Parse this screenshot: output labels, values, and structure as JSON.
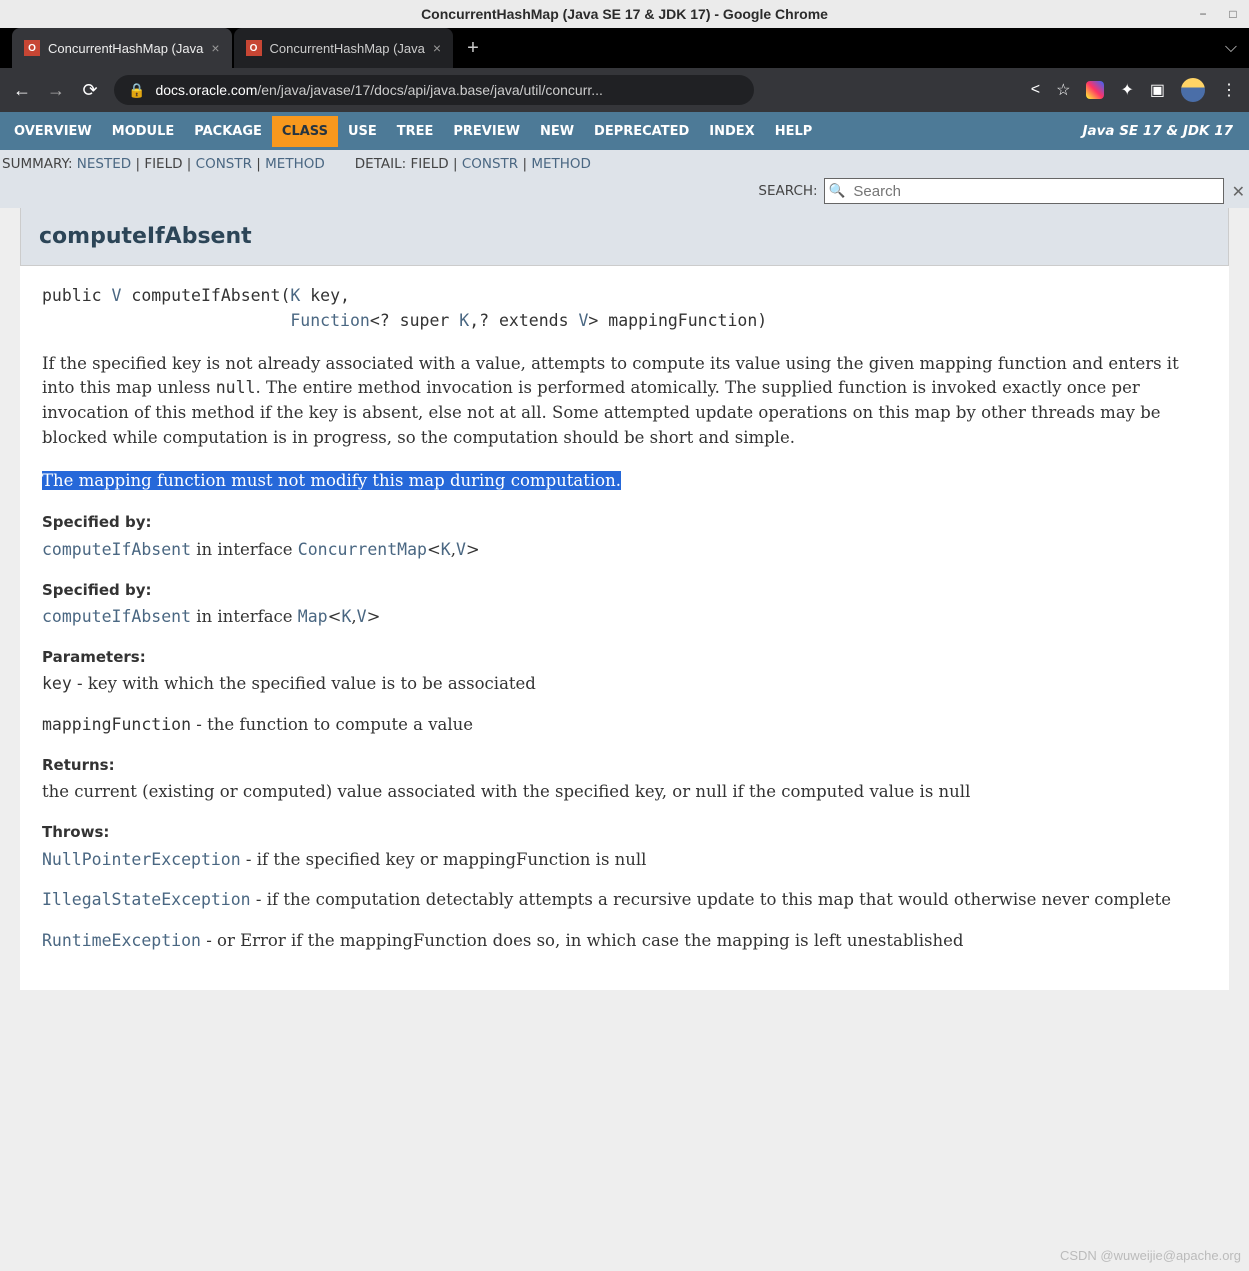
{
  "window": {
    "title": "ConcurrentHashMap (Java SE 17 & JDK 17) - Google Chrome"
  },
  "tabs": [
    {
      "title": "ConcurrentHashMap (Java"
    },
    {
      "title": "ConcurrentHashMap (Java"
    }
  ],
  "url": {
    "domain": "docs.oracle.com",
    "path": "/en/java/javase/17/docs/api/java.base/java/util/concurr..."
  },
  "nav": {
    "items": [
      "OVERVIEW",
      "MODULE",
      "PACKAGE",
      "CLASS",
      "USE",
      "TREE",
      "PREVIEW",
      "NEW",
      "DEPRECATED",
      "INDEX",
      "HELP"
    ],
    "selected": "CLASS",
    "version": "Java SE 17 & JDK 17"
  },
  "subnav": {
    "summary_label": "SUMMARY:",
    "summary_links": {
      "nested": "NESTED",
      "field": "FIELD",
      "constr": "CONSTR",
      "method": "METHOD"
    },
    "detail_label": "DETAIL:",
    "detail_links": {
      "field": "FIELD",
      "constr": "CONSTR",
      "method": "METHOD"
    },
    "search_label": "SEARCH:",
    "search_placeholder": "Search"
  },
  "section": {
    "heading": "computeIfAbsent",
    "signature": {
      "mods": "public",
      "ret": "V",
      "name": "computeIfAbsent",
      "p1_type": "K",
      "p1_name": "key,",
      "p2_type": "Function",
      "p2_generic": "<? super ",
      "p2_g2": "K",
      "p2_g3": ",? extends ",
      "p2_g4": "V",
      "p2_g5": "> mappingFunction)"
    },
    "desc1_a": "If the specified key is not already associated with a value, attempts to compute its value using the given mapping function and enters it into this map unless ",
    "desc1_null": "null",
    "desc1_b": ". The entire method invocation is performed atomically. The supplied function is invoked exactly once per invocation of this method if the key is absent, else not at all. Some attempted update operations on this map by other threads may be blocked while computation is in progress, so the computation should be short and simple.",
    "desc2": "The mapping function must not modify this map during computation.",
    "spec1": {
      "label": "Specified by:",
      "method": "computeIfAbsent",
      "mid": " in interface ",
      "iface": "ConcurrentMap",
      "gen": "<",
      "k": "K",
      "comma": ",",
      "v": "V",
      "close": ">"
    },
    "spec2": {
      "label": "Specified by:",
      "method": "computeIfAbsent",
      "mid": " in interface ",
      "iface": "Map",
      "gen": "<",
      "k": "K",
      "comma": ",",
      "v": "V",
      "close": ">"
    },
    "params": {
      "label": "Parameters:",
      "p1_name": "key",
      "p1_desc": " - key with which the specified value is to be associated",
      "p2_name": "mappingFunction",
      "p2_desc": " - the function to compute a value"
    },
    "returns": {
      "label": "Returns:",
      "text": "the current (existing or computed) value associated with the specified key, or null if the computed value is null"
    },
    "throws": {
      "label": "Throws:",
      "e1_name": "NullPointerException",
      "e1_desc": " - if the specified key or mappingFunction is null",
      "e2_name": "IllegalStateException",
      "e2_desc": " - if the computation detectably attempts a recursive update to this map that would otherwise never complete",
      "e3_name": "RuntimeException",
      "e3_desc": " - or Error if the mappingFunction does so, in which case the mapping is left unestablished"
    }
  },
  "watermark": "CSDN @wuweijie@apache.org"
}
